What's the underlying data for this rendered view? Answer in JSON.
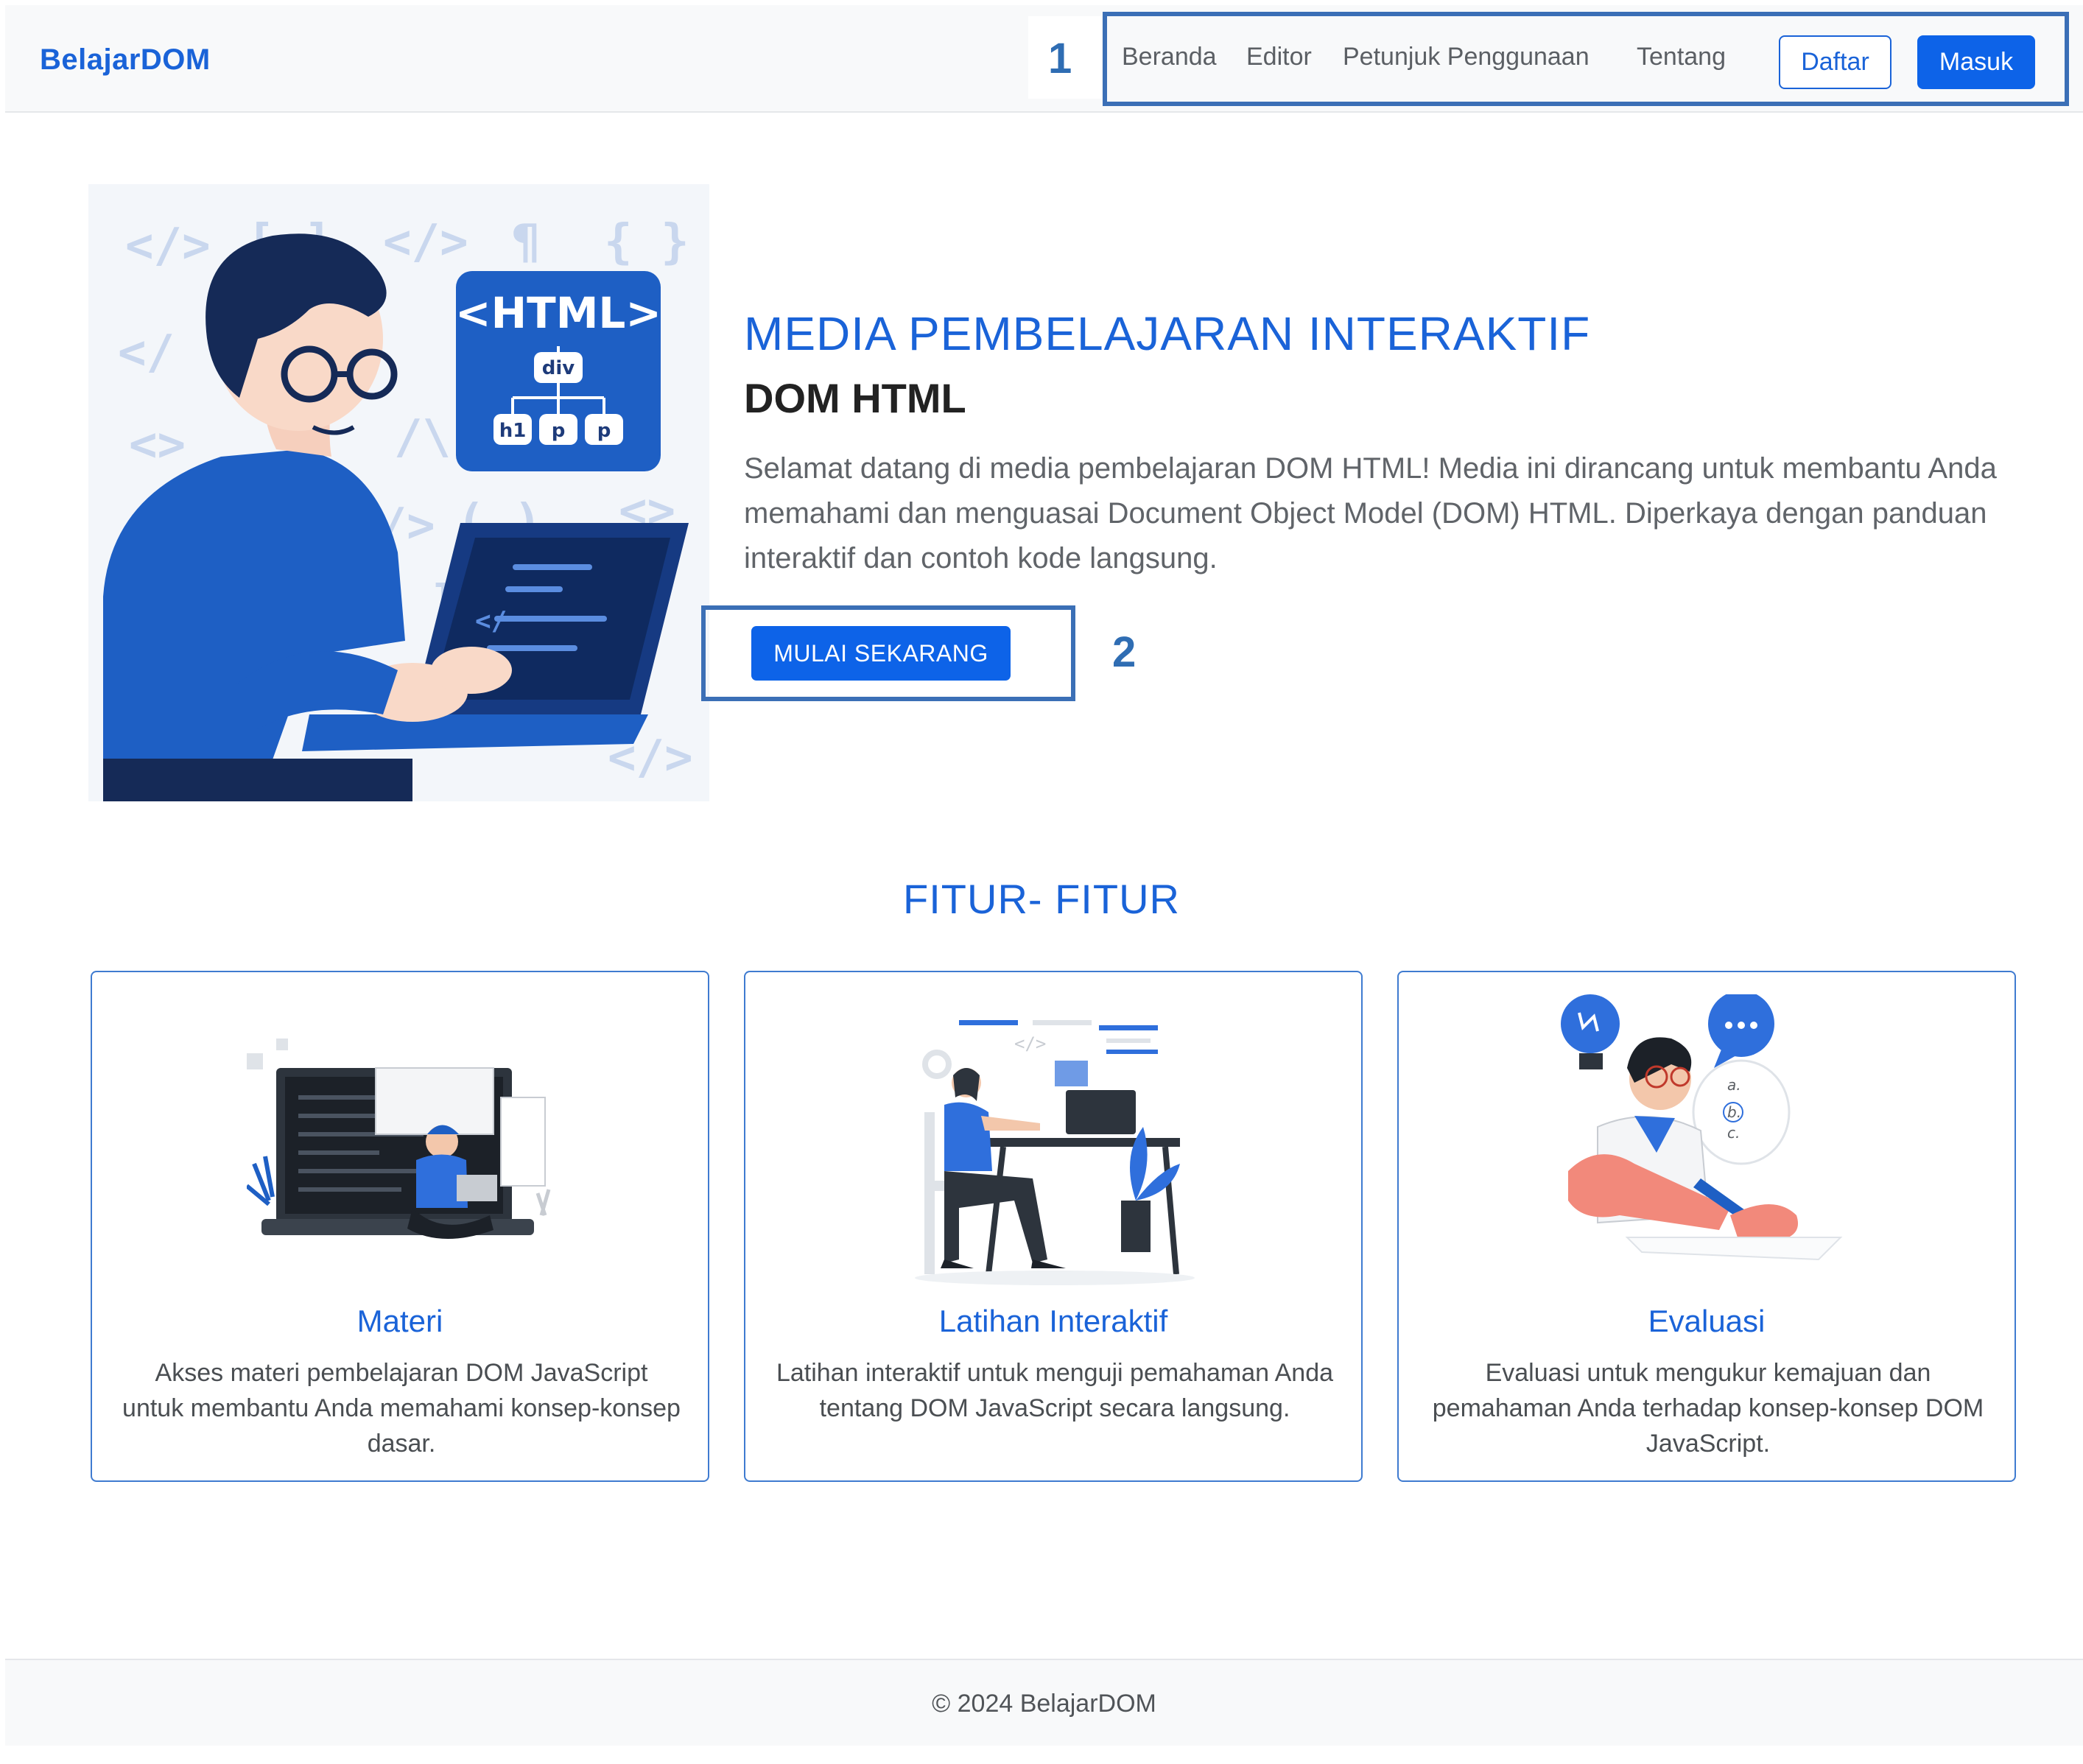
{
  "navbar": {
    "brand": "BelajarDOM",
    "links": [
      "Beranda",
      "Editor",
      "Petunjuk Penggunaan",
      "Tentang"
    ],
    "register_label": "Daftar",
    "login_label": "Masuk"
  },
  "annotations": {
    "marker_1": "1",
    "marker_2": "2"
  },
  "hero": {
    "title": "MEDIA PEMBELAJARAN INTERAKTIF",
    "subtitle": "DOM HTML",
    "description": "Selamat datang di media pembelajaran DOM HTML! Media ini dirancang untuk membantu Anda memahami dan menguasai Document Object Model (DOM) HTML. Diperkaya dengan panduan interaktif dan contoh kode langsung.",
    "cta_label": "MULAI SEKARANG",
    "illustration": {
      "badge_title": "<HTML>",
      "tree_root": "div",
      "tree_children": [
        "h1",
        "p",
        "p"
      ]
    }
  },
  "features": {
    "section_title": "FITUR- FITUR",
    "cards": [
      {
        "title": "Materi",
        "text": "Akses materi pembelajaran DOM JavaScript untuk membantu Anda memahami konsep-konsep dasar.",
        "icon": "laptop-learning-illustration"
      },
      {
        "title": "Latihan Interaktif",
        "text": "Latihan interaktif untuk menguji pemahaman Anda tentang DOM JavaScript secara langsung.",
        "icon": "desk-practice-illustration"
      },
      {
        "title": "Evaluasi",
        "text": "Evaluasi untuk mengukur kemajuan dan pemahaman Anda terhadap konsep-konsep DOM JavaScript.",
        "icon": "exam-evaluation-illustration",
        "quiz_options": [
          "a.",
          "b.",
          "c."
        ]
      }
    ]
  },
  "footer": {
    "text": "© 2024 BelajarDOM"
  },
  "colors": {
    "primary": "#0d63e8",
    "brand_text": "#1a63d8",
    "annotation": "#3b6fb6",
    "navbar_bg": "#f8f9fa"
  }
}
